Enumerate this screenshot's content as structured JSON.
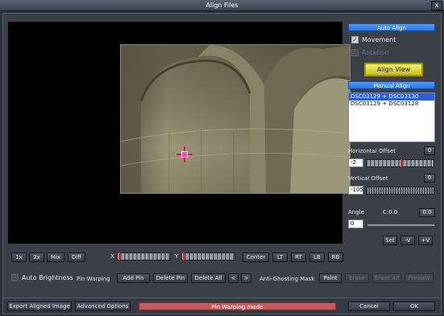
{
  "window": {
    "title": "Align Files",
    "close_glyph": "x"
  },
  "auto_align": {
    "header": "Auto Align",
    "movement_label": "Movement",
    "movement_checked": true,
    "rotation_label": "Rotation",
    "rotation_checked": false,
    "align_view_label": "Align View"
  },
  "manual_align": {
    "header": "Manual Align",
    "items": [
      "DSC03129 + DSC03130",
      "DSC03129 + DSC03128"
    ],
    "selected_index": 0,
    "horizontal_offset": {
      "label": "Horizontal Offset",
      "value": "-2",
      "reset": "0",
      "position_fraction": 0.5
    },
    "vertical_offset": {
      "label": "Vertical Offset",
      "value": "-105",
      "reset": "0"
    },
    "angle": {
      "label": "Angle",
      "center": "C:0.0",
      "value": "0",
      "reset": "0.0"
    },
    "set_label": "Set",
    "minus_v_label": "-V",
    "plus_v_label": "+V"
  },
  "preview_toolbar": {
    "zoom_1x": "1x",
    "zoom_2x": "2x",
    "mix": "Mix",
    "diff": "Diff",
    "x_label": "X",
    "y_label": "Y",
    "center": "Center",
    "lt": "LT",
    "rt": "RT",
    "lb": "LB",
    "rb": "RB"
  },
  "options_row": {
    "auto_brightness_label": "Auto Brightness",
    "auto_brightness_checked": false,
    "pin_warping_label": "Pin Warping",
    "add_pin": "Add Pin",
    "delete_pin": "Delete Pin",
    "delete_all": "Delete All",
    "prev": "<",
    "next": ">",
    "anti_ghosting_label": "Anti-Ghosting Mask",
    "paint": "Paint",
    "erase": "Erase",
    "erase_all": "Erase All",
    "preview": "Preview"
  },
  "footer": {
    "export_label": "Export Aligned Image",
    "advanced_label": "Advanced Options",
    "status_text": "Pin Warping mode",
    "cancel_label": "Cancel",
    "ok_label": "OK"
  },
  "colors": {
    "section_header": "#2a74dc",
    "highlight_button": "#e8e040",
    "status_bar": "#c35b5f",
    "crosshair": "#e5173f",
    "pin_marker": "#ff3fd2"
  }
}
